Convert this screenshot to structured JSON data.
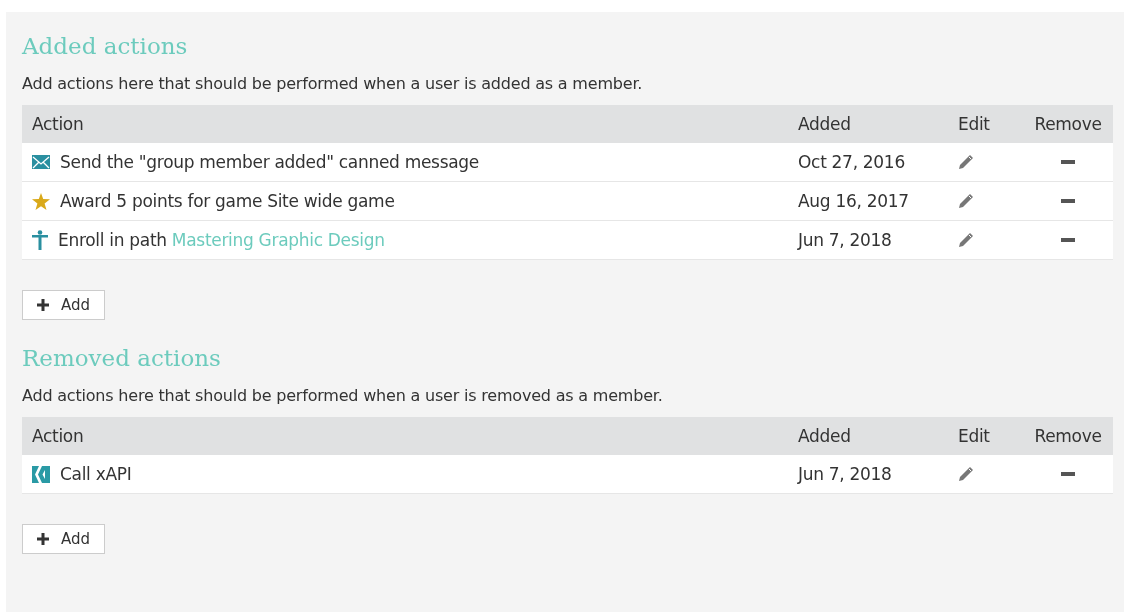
{
  "sections": [
    {
      "title": "Added actions",
      "description": "Add actions here that should be performed when a user is added as a member.",
      "columns": [
        "Action",
        "Added",
        "Edit",
        "Remove"
      ],
      "rows": [
        {
          "kind": "message",
          "text": "Send the \"group member added\" canned message",
          "added": "Oct 27, 2016"
        },
        {
          "kind": "points",
          "text": "Award 5 points for game Site wide game",
          "added": "Aug 16, 2017"
        },
        {
          "kind": "path",
          "text": "Enroll in path",
          "link": "Mastering Graphic Design",
          "added": "Jun 7, 2018"
        }
      ],
      "add_button": "Add"
    },
    {
      "title": "Removed actions",
      "description": "Add actions here that should be performed when a user is removed as a member.",
      "columns": [
        "Action",
        "Added",
        "Edit",
        "Remove"
      ],
      "rows": [
        {
          "kind": "xapi",
          "text": "Call xAPI",
          "added": "Jun 7, 2018"
        }
      ],
      "add_button": "Add"
    }
  ]
}
